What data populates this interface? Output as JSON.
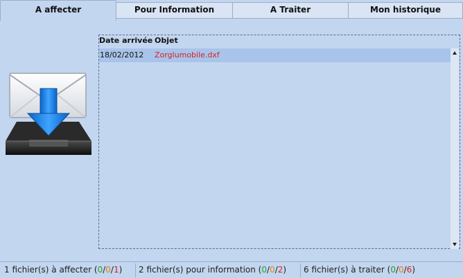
{
  "tabs": [
    {
      "label": "A affecter",
      "active": true
    },
    {
      "label": "Pour Information",
      "active": false
    },
    {
      "label": "A Traiter",
      "active": false
    },
    {
      "label": "Mon historique",
      "active": false
    }
  ],
  "table": {
    "headers": {
      "date": "Date arrivée",
      "object": "Objet"
    },
    "rows": [
      {
        "date": "18/02/2012",
        "object": "Zorglumobile.dxf"
      }
    ]
  },
  "status": {
    "affecter": {
      "label": "1 fichier(s) à affecter (",
      "green": "0",
      "orange": "0",
      "red": "1",
      "close": ")"
    },
    "information": {
      "label": "2 fichier(s) pour information (",
      "green": "0",
      "orange": "0",
      "red": "2",
      "close": ")"
    },
    "traiter": {
      "label": "6 fichier(s) à traiter (",
      "green": "0",
      "orange": "0",
      "red": "6",
      "close": ")"
    },
    "slash": "/"
  },
  "icons": {
    "inbox": "inbox-download-icon"
  },
  "colors": {
    "link": "#d62020",
    "green": "#2f9a2f",
    "orange": "#d8861a",
    "red": "#d62020"
  }
}
